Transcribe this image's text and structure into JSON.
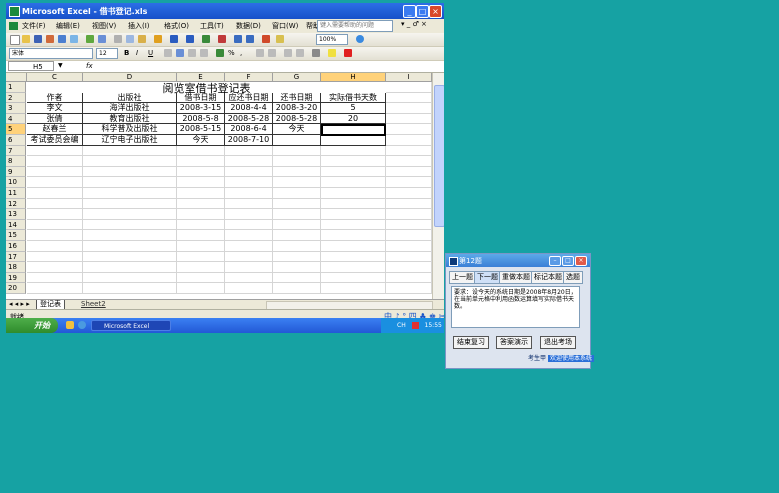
{
  "excel": {
    "title": "Microsoft Excel - 借书登记.xls",
    "menu": [
      "文件(F)",
      "编辑(E)",
      "视图(V)",
      "插入(I)",
      "格式(O)",
      "工具(T)",
      "数据(D)",
      "窗口(W)",
      "帮助(H)"
    ],
    "help_placeholder": "键入需要帮助的问题",
    "font_name": "宋体",
    "font_size": "12",
    "zoom": "100%",
    "name_box": "H5",
    "fx_label": "fx",
    "columns": [
      "C",
      "D",
      "E",
      "F",
      "G",
      "H",
      "I"
    ],
    "selected_column": "H",
    "title_cell": "阅览室借书登记表",
    "rows": [
      "1",
      "2",
      "3",
      "4",
      "5",
      "6",
      "7",
      "8",
      "9",
      "10",
      "11",
      "12",
      "13",
      "14",
      "15",
      "16",
      "17",
      "18",
      "19",
      "20"
    ],
    "selected_row": "5",
    "table": {
      "headers": [
        "作者",
        "出版社",
        "借书日期",
        "应还书日期",
        "还书日期",
        "实际借书天数"
      ],
      "data": [
        [
          "李文",
          "海洋出版社",
          "2008-3-15",
          "2008-4-4",
          "2008-3-20",
          "5"
        ],
        [
          "张倩",
          "教育出版社",
          "2008-5-8",
          "2008-5-28",
          "2008-5-28",
          "20"
        ],
        [
          "赵春兰",
          "科学普及出版社",
          "2008-5-15",
          "2008-6-4",
          "今天",
          ""
        ],
        [
          "考试委员会编",
          "辽宁电子出版社",
          "今天",
          "2008-7-10",
          "",
          ""
        ]
      ]
    },
    "sheet_tabs": [
      "登记表",
      "Sheet2"
    ],
    "status": "就绪",
    "ime_text": "中 ♪ ° 四 ♣ ♚ ✂"
  },
  "taskbar": {
    "start_label": "开始",
    "task_label": "Microsoft Excel",
    "tray_text": "CH",
    "clock": "15:55"
  },
  "quiz": {
    "title": "第12题",
    "window_buttons": [
      "–",
      "□",
      "×"
    ],
    "tabs": [
      "上一题",
      "下一题",
      "重做本题",
      "标记本题",
      "选题"
    ],
    "question": "要求：设今天的系统日期是2008年8月20日，在当前单元格中利用函数运算填写实际借书天数。",
    "buttons": [
      "结束复习",
      "答案演示",
      "退出考场"
    ],
    "examinee_label": "考生甲",
    "examinee_value": "欢迎使用本系统"
  },
  "colors": {
    "desktop": "#16a2a3",
    "title_blue": "#2c6fe6",
    "selected_header": "#ffd27a"
  }
}
